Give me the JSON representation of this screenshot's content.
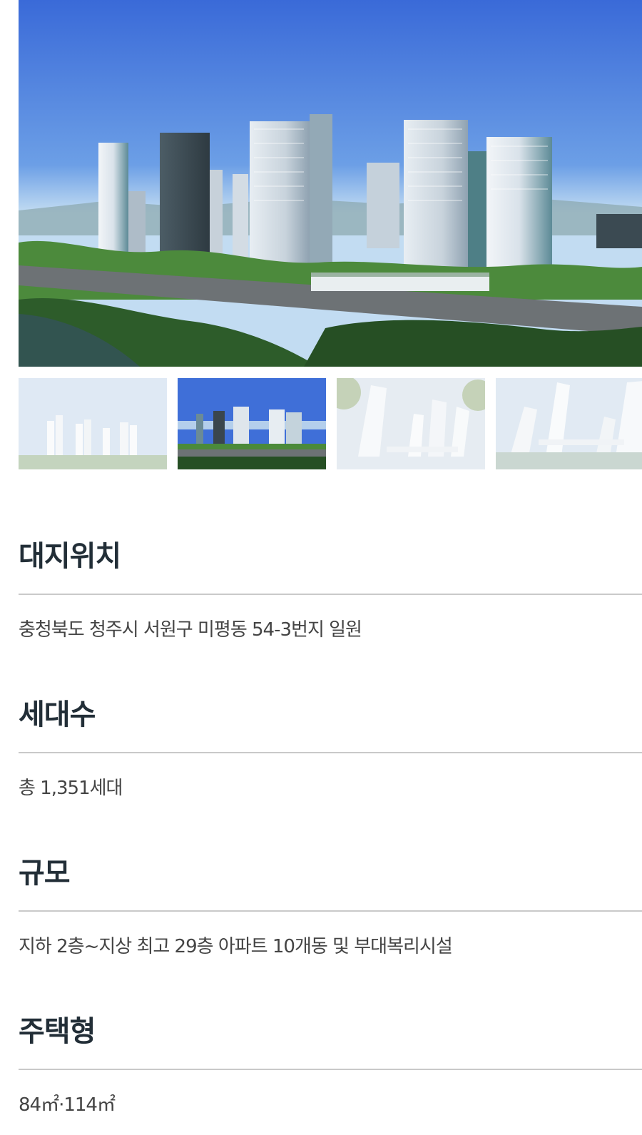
{
  "gallery": {
    "main_alt": "단지 투시도",
    "thumbnails": [
      {
        "label": "단지 전경 투시도 1",
        "selected": false
      },
      {
        "label": "단지 전경 투시도 2",
        "selected": true
      },
      {
        "label": "단지 투시도 3",
        "selected": false
      },
      {
        "label": "단지 투시도 4",
        "selected": false
      }
    ]
  },
  "sections": [
    {
      "title": "대지위치",
      "value": "충청북도 청주시 서원구 미평동 54-3번지 일원"
    },
    {
      "title": "세대수",
      "value": "총 1,351세대"
    },
    {
      "title": "규모",
      "value": "지하 2층~지상 최고 29층 아파트 10개동 및 부대복리시설"
    },
    {
      "title": "주택형",
      "value": "84㎡·114㎡"
    }
  ],
  "colors": {
    "heading": "#222e37",
    "body_text": "#444444",
    "divider": "#c9c9c9",
    "sky": "#3e6ed6"
  }
}
